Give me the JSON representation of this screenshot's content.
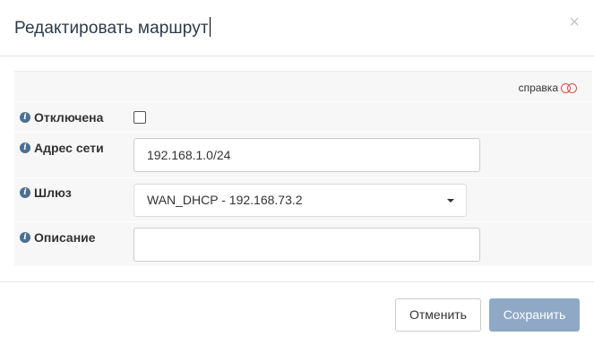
{
  "dialog": {
    "title": "Редактировать маршрут",
    "close_glyph": "×"
  },
  "help": {
    "label": "справка",
    "toggle_color": "#e34b4b"
  },
  "fields": {
    "disabled": {
      "label": "Отключена",
      "checked": false
    },
    "network": {
      "label": "Адрес сети",
      "value": "192.168.1.0/24"
    },
    "gateway": {
      "label": "Шлюз",
      "selected": "WAN_DHCP - 192.168.73.2"
    },
    "description": {
      "label": "Описание",
      "value": ""
    }
  },
  "info_icon_glyph": "i",
  "footer": {
    "cancel_label": "Отменить",
    "save_label": "Сохранить"
  },
  "colors": {
    "title": "#2b3a4a",
    "info_icon": "#4a6f92",
    "save_button": "#8fa8c6"
  }
}
